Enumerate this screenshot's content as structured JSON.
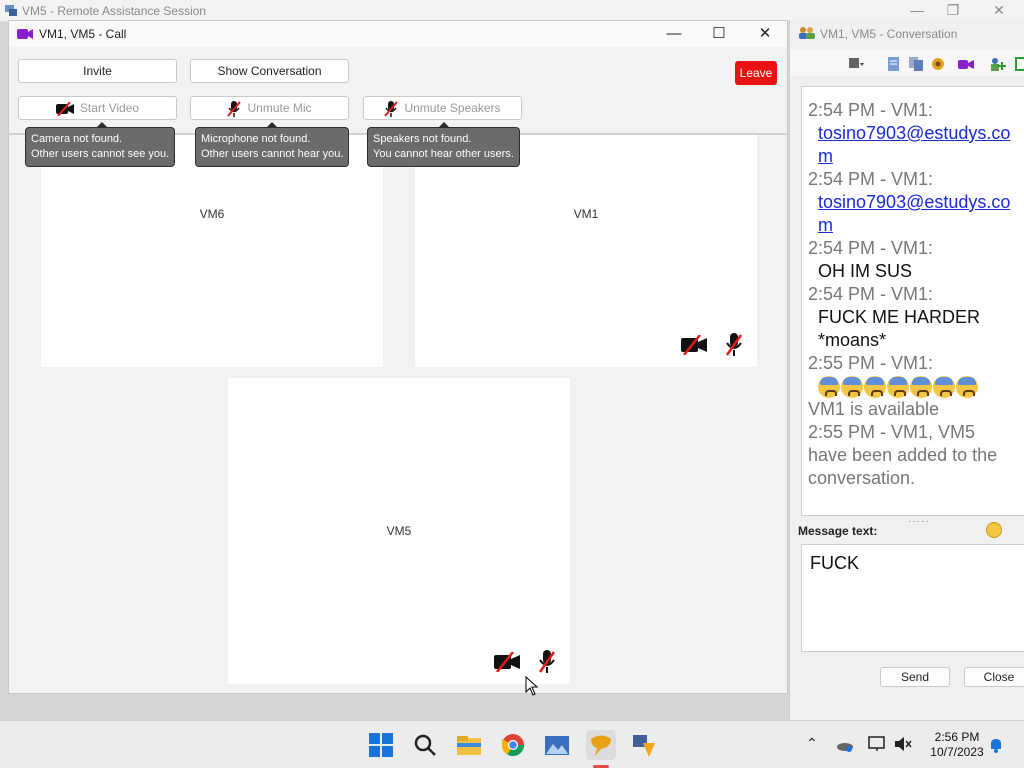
{
  "outer_window": {
    "title": "VM5 - Remote Assistance Session"
  },
  "call_window": {
    "title": "VM1, VM5 - Call",
    "buttons": {
      "invite": "Invite",
      "show_conversation": "Show Conversation",
      "leave": "Leave",
      "start_video": "Start Video",
      "unmute_mic": "Unmute Mic",
      "unmute_speakers": "Unmute Speakers"
    },
    "tooltips": {
      "camera": [
        "Camera not found.",
        "Other users cannot see you."
      ],
      "mic": [
        "Microphone not found.",
        "Other users cannot hear you."
      ],
      "speakers": [
        "Speakers not found.",
        "You cannot hear other users."
      ]
    },
    "participants": [
      "VM6",
      "VM1",
      "VM5"
    ],
    "colors": {
      "leave_bg": "#e81212",
      "muted_icon_slash": "#e01b1b"
    }
  },
  "conversation": {
    "title": "VM1, VM5 - Conversation",
    "messages": [
      {
        "header": "2:54 PM - VM1:",
        "link": "tosino7903@estudys.com"
      },
      {
        "header": "2:54 PM - VM1:",
        "link": "tosino7903@estudys.com"
      },
      {
        "header": "2:54 PM - VM1:",
        "text": "OH IM SUS"
      },
      {
        "header": "2:54 PM - VM1:",
        "text": "FUCK ME HARDER *moans*"
      },
      {
        "header": "2:55 PM - VM1:",
        "emoji_count": 7
      }
    ],
    "status_1": "VM1 is available",
    "status_2": "2:55 PM - VM1, VM5 have been added to the conversation.",
    "message_label": "Message text:",
    "input_value": "FUCK",
    "send": "Send",
    "close": "Close"
  },
  "taskbar": {
    "time": "2:56 PM",
    "date": "10/7/2023"
  }
}
